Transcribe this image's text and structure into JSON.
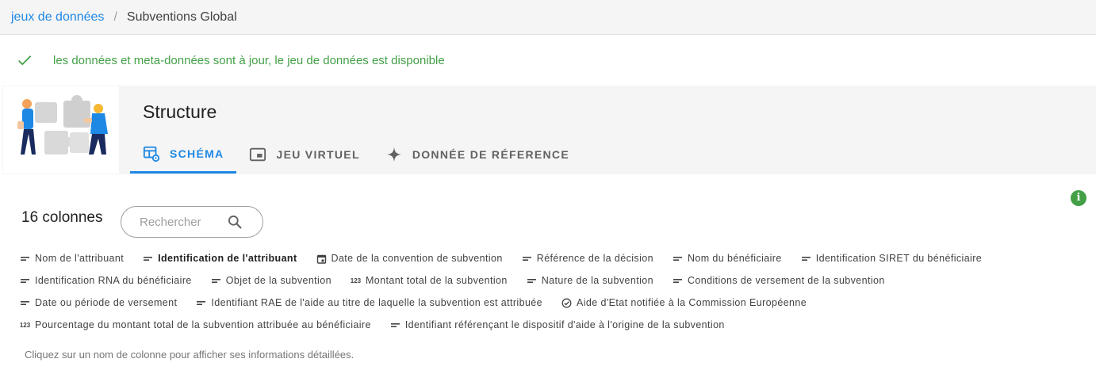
{
  "breadcrumb": {
    "root": "jeux de données",
    "separator": "/",
    "current": "Subventions Global"
  },
  "status": {
    "message": "les données et meta-données sont à jour, le jeu de données est disponible",
    "color": "#43a047"
  },
  "structure": {
    "title": "Structure",
    "tabs": [
      {
        "label": "SCHÉMA",
        "icon": "table-cog-icon",
        "active": true
      },
      {
        "label": "JEU VIRTUEL",
        "icon": "picture-in-picture-icon",
        "active": false
      },
      {
        "label": "DONNÉE DE RÉFERENCE",
        "icon": "sparkle-icon",
        "active": false
      }
    ]
  },
  "schema": {
    "count_label": "16 colonnes",
    "search_placeholder": "Rechercher",
    "columns": [
      {
        "label": "Nom de l'attribuant",
        "type": "text"
      },
      {
        "label": "Identification de l'attribuant",
        "type": "text-bold"
      },
      {
        "label": "Date de la convention de subvention",
        "type": "date"
      },
      {
        "label": "Référence de la décision",
        "type": "text"
      },
      {
        "label": "Nom du bénéficiaire",
        "type": "text"
      },
      {
        "label": "Identification SIRET du bénéficiaire",
        "type": "text"
      },
      {
        "label": "Identification RNA du bénéficiaire",
        "type": "text"
      },
      {
        "label": "Objet de la subvention",
        "type": "text"
      },
      {
        "label": "Montant total de la subvention",
        "type": "number"
      },
      {
        "label": "Nature de la subvention",
        "type": "text"
      },
      {
        "label": "Conditions de versement de la subvention",
        "type": "text"
      },
      {
        "label": "Date ou période de versement",
        "type": "text"
      },
      {
        "label": "Identifiant RAE de l'aide au titre de laquelle la subvention est attribuée",
        "type": "text"
      },
      {
        "label": "Aide d'Etat notifiée à la Commission Européenne",
        "type": "boolean"
      },
      {
        "label": "Pourcentage du montant total de la subvention attribuée au bénéficiaire",
        "type": "number"
      },
      {
        "label": "Identifiant référençant le dispositif d'aide à l'origine de la subvention",
        "type": "text"
      }
    ],
    "number_icon_text": "123",
    "hint": "Cliquez sur un nom de colonne pour afficher ses informations détaillées."
  },
  "colors": {
    "accent": "#1e88e5",
    "success": "#43a047"
  }
}
